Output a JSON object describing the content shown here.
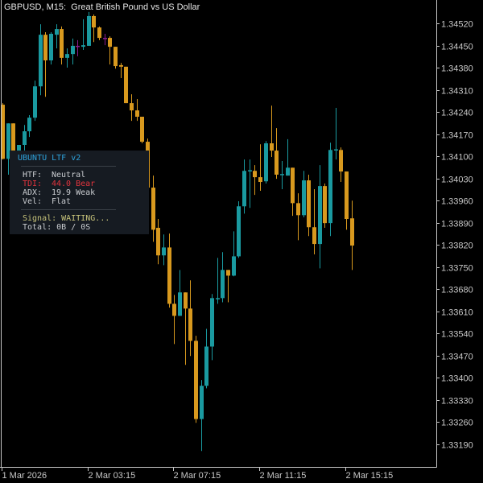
{
  "header": {
    "symbol": "GBPUSD, M15:",
    "description": "Great British Pound vs US Dollar"
  },
  "panel": {
    "title": "UBUNTU LTF v2",
    "rows": [
      {
        "label": "HTF:",
        "value": "Neutral"
      },
      {
        "label": "TDI:",
        "value": "44.0 Bear"
      },
      {
        "label": "ADX:",
        "value": "19.9 Weak"
      },
      {
        "label": "Vel:",
        "value": "Flat"
      }
    ],
    "signal": "Signal: WAITING...",
    "total": "Total: 0B / 0S"
  },
  "colors": {
    "bull": "#1a9aa0",
    "bear": "#d8991e",
    "doji": "#8a1c8e",
    "axis": "#c8c8c8",
    "tdi": "#e2343d"
  },
  "chart_data": {
    "type": "candlestick",
    "title": "GBPUSD, M15",
    "ylim": [
      1.33155,
      1.3459
    ],
    "y_ticks": [
      "1.34520",
      "1.34450",
      "1.34380",
      "1.34310",
      "1.34240",
      "1.34170",
      "1.34100",
      "1.34030",
      "1.33960",
      "1.33890",
      "1.33820",
      "1.33750",
      "1.33680",
      "1.33610",
      "1.33540",
      "1.33470",
      "1.33400",
      "1.33330",
      "1.33260",
      "1.33190"
    ],
    "x_ticks": [
      {
        "index": 0,
        "label": "1 Mar 2026"
      },
      {
        "index": 16,
        "label": "2 Mar 03:15"
      },
      {
        "index": 32,
        "label": "2 Mar 07:15"
      },
      {
        "index": 48,
        "label": "2 Mar 11:15"
      },
      {
        "index": 64,
        "label": "2 Mar 15:15"
      }
    ],
    "ohlc": [
      [
        1.34263,
        1.34268,
        1.3409,
        1.34092
      ],
      [
        1.34092,
        1.34204,
        1.34042,
        1.34204
      ],
      [
        1.34204,
        1.34204,
        1.34029,
        1.34052
      ],
      [
        1.34052,
        1.34136,
        1.34029,
        1.34136
      ],
      [
        1.34136,
        1.34199,
        1.3411,
        1.34179
      ],
      [
        1.34179,
        1.3423,
        1.34161,
        1.34222
      ],
      [
        1.34222,
        1.34339,
        1.34212,
        1.34321
      ],
      [
        1.34321,
        1.34517,
        1.34293,
        1.34484
      ],
      [
        1.34484,
        1.34492,
        1.34288,
        1.34403
      ],
      [
        1.34403,
        1.34492,
        1.3439,
        1.34487
      ],
      [
        1.34484,
        1.34517,
        1.34441,
        1.34502
      ],
      [
        1.34502,
        1.3451,
        1.3439,
        1.34411
      ],
      [
        1.34411,
        1.34441,
        1.3438,
        1.34423
      ],
      [
        1.34423,
        1.34472,
        1.3439,
        1.34449
      ],
      [
        1.34449,
        1.34467,
        1.34416,
        1.34449
      ],
      [
        1.34446,
        1.34533,
        1.34436,
        1.34451
      ],
      [
        1.34449,
        1.34556,
        1.34449,
        1.34543
      ],
      [
        1.34543,
        1.34548,
        1.34461,
        1.34507
      ],
      [
        1.34507,
        1.3451,
        1.34467,
        1.34474
      ],
      [
        1.34474,
        1.34487,
        1.34451,
        1.34474
      ],
      [
        1.34474,
        1.34479,
        1.3439,
        1.34446
      ],
      [
        1.34446,
        1.34446,
        1.34377,
        1.34385
      ],
      [
        1.34388,
        1.34395,
        1.34347,
        1.34383
      ],
      [
        1.34383,
        1.34383,
        1.34268,
        1.34268
      ],
      [
        1.34268,
        1.34296,
        1.34212,
        1.34245
      ],
      [
        1.34245,
        1.34281,
        1.34212,
        1.34225
      ],
      [
        1.34225,
        1.34225,
        1.34141,
        1.34146
      ],
      [
        1.34146,
        1.34156,
        1.34001,
        1.34001
      ],
      [
        1.34001,
        1.34039,
        1.3383,
        1.33868
      ],
      [
        1.33874,
        1.33902,
        1.33759,
        1.33787
      ],
      [
        1.33787,
        1.33853,
        1.33756,
        1.33812
      ],
      [
        1.33812,
        1.33856,
        1.33622,
        1.33634
      ],
      [
        1.33634,
        1.33662,
        1.33507,
        1.33596
      ],
      [
        1.33596,
        1.33741,
        1.33596,
        1.3367
      ],
      [
        1.3367,
        1.3367,
        1.33441,
        1.33619
      ],
      [
        1.33619,
        1.33708,
        1.33469,
        1.33517
      ],
      [
        1.33517,
        1.33533,
        1.33258,
        1.3327
      ],
      [
        1.3327,
        1.33393,
        1.33169,
        1.33375
      ],
      [
        1.33375,
        1.33555,
        1.33367,
        1.33499
      ],
      [
        1.33499,
        1.33665,
        1.33456,
        1.33652
      ],
      [
        1.3365,
        1.33779,
        1.33634,
        1.33652
      ],
      [
        1.33652,
        1.33797,
        1.33639,
        1.33741
      ],
      [
        1.33741,
        1.33741,
        1.33639,
        1.33723
      ],
      [
        1.33723,
        1.33863,
        1.33721,
        1.33784
      ],
      [
        1.33784,
        1.33958,
        1.33779,
        1.33942
      ],
      [
        1.33942,
        1.3409,
        1.33919,
        1.34054
      ],
      [
        1.34054,
        1.3409,
        1.33937,
        1.34056
      ],
      [
        1.34054,
        1.34072,
        1.33978,
        1.34034
      ],
      [
        1.34034,
        1.34138,
        1.33991,
        1.34019
      ],
      [
        1.34021,
        1.34148,
        1.34014,
        1.34141
      ],
      [
        1.34141,
        1.3426,
        1.34098,
        1.34118
      ],
      [
        1.34118,
        1.34189,
        1.34029,
        1.34042
      ],
      [
        1.34042,
        1.34085,
        1.33996,
        1.34044
      ],
      [
        1.34039,
        1.34154,
        1.34039,
        1.34064
      ],
      [
        1.34064,
        1.34064,
        1.33912,
        1.33952
      ],
      [
        1.33952,
        1.33983,
        1.33835,
        1.33914
      ],
      [
        1.33914,
        1.34054,
        1.33907,
        1.34024
      ],
      [
        1.34024,
        1.34042,
        1.33848,
        1.33876
      ],
      [
        1.33876,
        1.33996,
        1.3379,
        1.33823
      ],
      [
        1.33823,
        1.34072,
        1.33746,
        1.34006
      ],
      [
        1.34006,
        1.34014,
        1.33874,
        1.33889
      ],
      [
        1.33889,
        1.34143,
        1.33848,
        1.3412
      ],
      [
        1.3412,
        1.34253,
        1.3409,
        1.34122
      ],
      [
        1.3412,
        1.34128,
        1.34019,
        1.34052
      ],
      [
        1.34052,
        1.34052,
        1.33868,
        1.33902
      ],
      [
        1.33904,
        1.3396,
        1.33741,
        1.33818
      ]
    ]
  }
}
